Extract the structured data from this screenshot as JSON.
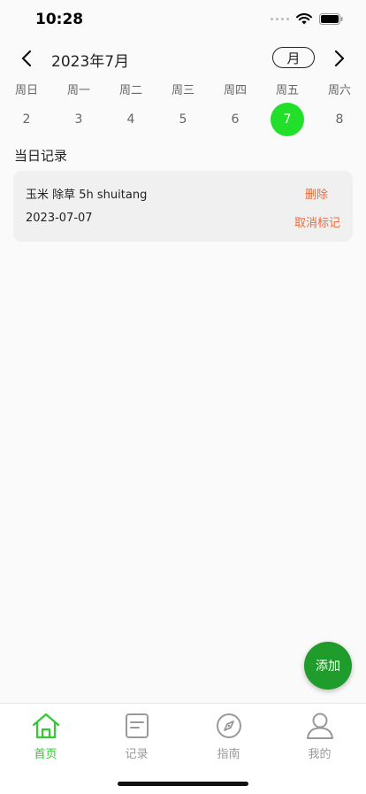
{
  "status_bar": {
    "time": "10:28"
  },
  "header": {
    "month_title": "2023年7月",
    "view_toggle": "月"
  },
  "week": [
    {
      "name": "周日",
      "num": "2",
      "selected": false
    },
    {
      "name": "周一",
      "num": "3",
      "selected": false
    },
    {
      "name": "周二",
      "num": "4",
      "selected": false
    },
    {
      "name": "周三",
      "num": "5",
      "selected": false
    },
    {
      "name": "周四",
      "num": "6",
      "selected": false
    },
    {
      "name": "周五",
      "num": "7",
      "selected": true
    },
    {
      "name": "周六",
      "num": "8",
      "selected": false
    }
  ],
  "section": {
    "title": "当日记录"
  },
  "records": [
    {
      "title": "玉米 除草 5h shuitang",
      "date": "2023-07-07",
      "delete_label": "删除",
      "unmark_label": "取消标记"
    }
  ],
  "fab": {
    "label": "添加"
  },
  "tabs": [
    {
      "label": "首页",
      "icon": "home-icon",
      "active": true
    },
    {
      "label": "记录",
      "icon": "notes-icon",
      "active": false
    },
    {
      "label": "指南",
      "icon": "compass-icon",
      "active": false
    },
    {
      "label": "我的",
      "icon": "user-icon",
      "active": false
    }
  ],
  "colors": {
    "accent": "#22e02a",
    "fab": "#1f9c2b",
    "action": "#ef6a3c",
    "tab_active": "#2ecc2e",
    "tab_inactive": "#999999"
  }
}
